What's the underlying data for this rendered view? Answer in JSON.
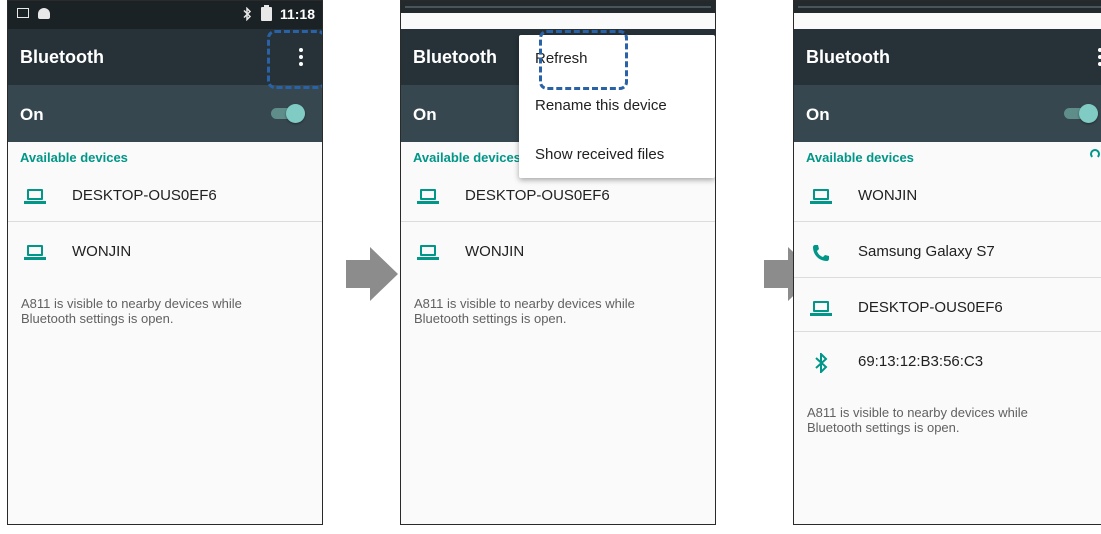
{
  "status_bar": {
    "time": "11:18"
  },
  "screens": [
    {
      "app_title": "Bluetooth",
      "on_label": "On",
      "section_header": "Available devices",
      "devices": [
        {
          "name": "DESKTOP-OUS0EF6",
          "icon": "laptop-icon"
        },
        {
          "name": "WONJIN",
          "icon": "laptop-icon"
        }
      ],
      "info_lines": [
        "A811 is visible to nearby devices while",
        "Bluetooth settings is open."
      ]
    },
    {
      "app_title": "Bluetooth",
      "on_label": "On",
      "section_header": "Available devices",
      "devices": [
        {
          "name": "DESKTOP-OUS0EF6",
          "icon": "laptop-icon"
        },
        {
          "name": "WONJIN",
          "icon": "laptop-icon"
        }
      ],
      "info_lines": [
        "A811 is visible to nearby devices while",
        "Bluetooth settings is open."
      ],
      "menu": {
        "items": [
          "Refresh",
          "Rename this device",
          "Show received files"
        ]
      }
    },
    {
      "app_title": "Bluetooth",
      "on_label": "On",
      "section_header": "Available devices",
      "devices": [
        {
          "name": "WONJIN",
          "icon": "laptop-icon"
        },
        {
          "name": "Samsung Galaxy S7",
          "icon": "phone-icon"
        },
        {
          "name": "DESKTOP-OUS0EF6",
          "icon": "laptop-icon"
        },
        {
          "name": "69:13:12:B3:56:C3",
          "icon": "bluetooth-icon"
        }
      ],
      "info_lines": [
        "A811 is visible to nearby devices while",
        "Bluetooth settings is open."
      ]
    }
  ],
  "colors": {
    "appbar": "#263238",
    "onbar": "#37474f",
    "accent": "#009688",
    "highlight": "#2a62a8",
    "arrow": "#8c8c8c"
  }
}
